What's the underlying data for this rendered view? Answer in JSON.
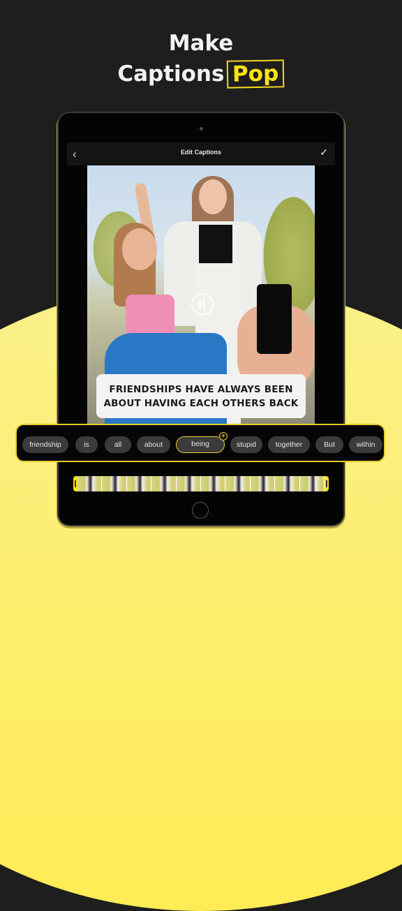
{
  "headline": {
    "line1": "Make",
    "line2_prefix": "Captions",
    "line2_highlight": "Pop"
  },
  "colors": {
    "accent": "#fde312",
    "background": "#1e1e1f",
    "arc": "#ffec55"
  },
  "editor": {
    "title": "Edit Captions",
    "back_icon": "‹",
    "done_icon": "✓",
    "caption_text": "FRIENDSHIPS HAVE ALWAYS BEEN ABOUT HAVING EACH OTHERS BACK",
    "playback_state": "playing"
  },
  "words": [
    {
      "label": "friendship"
    },
    {
      "label": "is"
    },
    {
      "label": "all"
    },
    {
      "label": "about"
    },
    {
      "label": "being",
      "selected": true
    },
    {
      "label": "stupid"
    },
    {
      "label": "together"
    },
    {
      "label": "But"
    },
    {
      "label": "within"
    }
  ],
  "add_word_icon": "+"
}
